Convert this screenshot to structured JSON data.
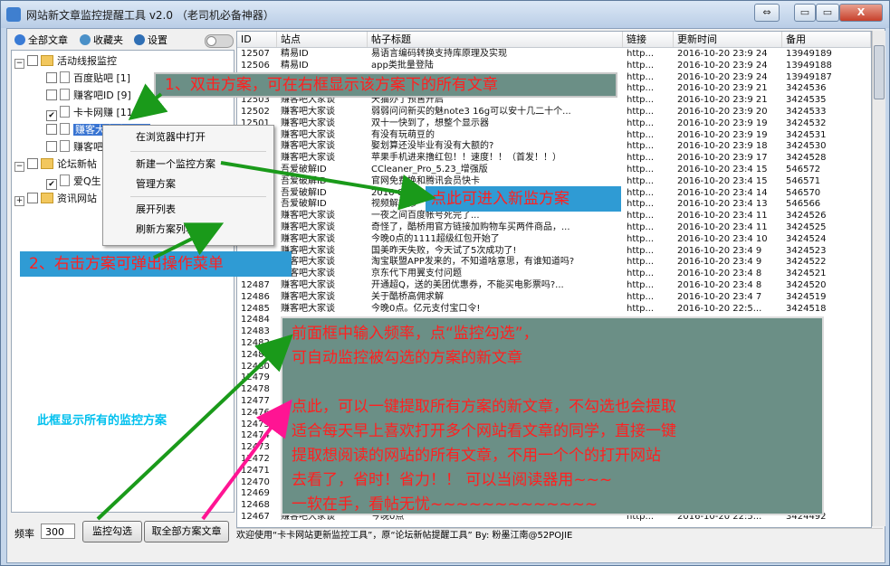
{
  "window": {
    "title": "网站新文章监控提醒工具 v2.0 （老司机必备神器）",
    "buttons": {
      "restore": "⇔",
      "minimize": "▭",
      "maximize": "▭",
      "close": "X"
    }
  },
  "toolbar": {
    "all_articles": "全部文章",
    "favorites": "收藏夹",
    "settings": "设置"
  },
  "tree": {
    "groups": [
      {
        "label": "活动线报监控",
        "items": [
          {
            "label": "百度贴吧 [1]",
            "checked": false
          },
          {
            "label": "赚客吧ID [9]",
            "checked": false
          },
          {
            "label": "卡卡网赚 [11]",
            "checked": true
          },
          {
            "label": "赚客大家谈 [15]",
            "checked": false,
            "selected": true
          },
          {
            "label": "赚客吧",
            "checked": false
          }
        ]
      },
      {
        "label": "论坛新帖",
        "items": [
          {
            "label": "爱Q生",
            "checked": true
          }
        ]
      },
      {
        "label": "资讯网站",
        "items": []
      }
    ],
    "note": "此框显示所有的监控方案"
  },
  "context_menu": {
    "items": [
      "在浏览器中打开",
      "新建一个监控方案",
      "管理方案",
      "展开列表",
      "刷新方案列表"
    ]
  },
  "bottom": {
    "freq_label": "频率",
    "freq_value": "300",
    "monitor_button": "监控勾选",
    "fetch_all_button": "取全部方案文章"
  },
  "list": {
    "columns": [
      "ID",
      "站点",
      "帖子标题",
      "链接",
      "更新时间",
      "备用"
    ],
    "rows": [
      [
        "12507",
        "精易ID",
        "易语言编码转换支持库原理及实现",
        "http...",
        "2016-10-20 23:9 24",
        "13949189"
      ],
      [
        "12506",
        "精易ID",
        "app类批量登陆",
        "http...",
        "2016-10-20 23:9 24",
        "13949188"
      ],
      [
        "",
        "",
        "",
        "http...",
        "2016-10-20 23:9 24",
        "13949187"
      ],
      [
        "",
        "",
        "",
        "http...",
        "2016-10-20 23:9 21",
        "3424536"
      ],
      [
        "12503",
        "赚客吧大家谈",
        "天猫办了预售开启",
        "http...",
        "2016-10-20 23:9 21",
        "3424535"
      ],
      [
        "12502",
        "赚客吧大家谈",
        "弱弱问问新买的魅note3 16g可以安十几二十个...",
        "http...",
        "2016-10-20 23:9 20",
        "3424533"
      ],
      [
        "12501",
        "赚客吧大家谈",
        "双十一快到了，想整个显示器",
        "http...",
        "2016-10-20 23:9 19",
        "3424532"
      ],
      [
        "",
        "赚客吧大家谈",
        "有没有玩萌豆的",
        "http...",
        "2016-10-20 23:9 19",
        "3424531"
      ],
      [
        "",
        "赚客吧大家谈",
        "娶划算还没毕业有没有大额的?",
        "http...",
        "2016-10-20 23:9 18",
        "3424530"
      ],
      [
        "",
        "赚客吧大家谈",
        "苹果手机进来撸红包！！速度！！（首发！！）",
        "http...",
        "2016-10-20 23:9 17",
        "3424528"
      ],
      [
        "",
        "吾爱破解ID",
        "CCleaner_Pro_5.23_增强版",
        "http...",
        "2016-10-20 23:4 15",
        "546572"
      ],
      [
        "",
        "吾爱破解ID",
        "官网免费换和腾讯会员快卡",
        "http...",
        "2016-10-20 23:4 15",
        "546571"
      ],
      [
        "",
        "吾爱破解ID",
        "2016 Google",
        "http...",
        "2016-10-20 23:4 14",
        "546570"
      ],
      [
        "",
        "吾爱破解ID",
        "视频解析修",
        "http...",
        "2016-10-20 23:4 13",
        "546566"
      ],
      [
        "",
        "赚客吧大家谈",
        "一夜之间百度帐号死完了...",
        "http...",
        "2016-10-20 23:4 11",
        "3424526"
      ],
      [
        "",
        "赚客吧大家谈",
        "奇怪了，酷桥用官方链接加购物车买两件商品，...",
        "http...",
        "2016-10-20 23:4 11",
        "3424525"
      ],
      [
        "",
        "赚客吧大家谈",
        "今晚0点的1111超级红包开始了",
        "http...",
        "2016-10-20 23:4 10",
        "3424524"
      ],
      [
        "",
        "赚客吧大家谈",
        "国美昨天失败，今天试了5次成功了!",
        "http...",
        "2016-10-20 23:4 9",
        "3424523"
      ],
      [
        "",
        "赚客吧大家谈",
        "淘宝联盟APP发来的，不知道啥意思，有谁知道吗?",
        "http...",
        "2016-10-20 23:4 9",
        "3424522"
      ],
      [
        "",
        "赚客吧大家谈",
        "京东代下用翼支付问题",
        "http...",
        "2016-10-20 23:4 8",
        "3424521"
      ],
      [
        "12487",
        "赚客吧大家谈",
        "开通超Q，送的美团优惠券，不能买电影票吗?...",
        "http...",
        "2016-10-20 23:4 8",
        "3424520"
      ],
      [
        "12486",
        "赚客吧大家谈",
        "关于酷桥高佣求解",
        "http...",
        "2016-10-20 23:4 7",
        "3424519"
      ],
      [
        "12485",
        "赚客吧大家谈",
        "今晚0点。亿元支付宝口令!",
        "http...",
        "2016-10-20 22:5...",
        "3424518"
      ],
      [
        "12484",
        "",
        "",
        "",
        "",
        ""
      ],
      [
        "12483",
        "",
        "",
        "",
        "",
        ""
      ],
      [
        "12482",
        "",
        "",
        "",
        "",
        ""
      ],
      [
        "12481",
        "",
        "",
        "",
        "",
        ""
      ],
      [
        "12480",
        "",
        "",
        "",
        "",
        ""
      ],
      [
        "12479",
        "",
        "",
        "",
        "",
        ""
      ],
      [
        "12478",
        "",
        "",
        "",
        "",
        "6"
      ],
      [
        "12477",
        "",
        "",
        "",
        "",
        "6"
      ],
      [
        "12476",
        "",
        "",
        "",
        "",
        ""
      ],
      [
        "12475",
        "",
        "",
        "",
        "",
        ""
      ],
      [
        "12474",
        "",
        "",
        "",
        "",
        ""
      ],
      [
        "12473",
        "",
        "",
        "",
        "",
        ""
      ],
      [
        "12472",
        "",
        "",
        "",
        "",
        ""
      ],
      [
        "12471",
        "",
        "",
        "",
        "",
        ""
      ],
      [
        "12470",
        "",
        "",
        "",
        "",
        ""
      ],
      [
        "12469",
        "",
        "",
        "",
        "",
        ""
      ],
      [
        "12468",
        "",
        "",
        "",
        "",
        ""
      ],
      [
        "12467",
        "赚客吧大家谈",
        "今晚0点",
        "http...",
        "2016-10-20 22:5...",
        "3424492"
      ]
    ]
  },
  "statusbar": "欢迎使用“卡卡网站更新监控工具”，原“论坛新帖提醒工具” By: 粉墨江南@52POJIE",
  "annotations": {
    "a1": "1、双击方案，可在右框显示该方案下的所有文章",
    "a2": "2、右击方案可弹出操作菜单",
    "a3": "点此可进入新监方案",
    "big": [
      "前面框中输入频率，点“监控勾选”，",
      "可自动监控被勾选的方案的新文章",
      "",
      "点此，可以一键提取所有方案的新文章，不勾选也会提取",
      "适合每天早上喜欢打开多个网站看文章的同学，直接一键",
      "提取想阅读的网站的所有文章，不用一个个的打开网站",
      "去看了，省时！省力！！ 可以当阅读器用~~~",
      "一软在手，看帖无忧~~~~~~~~~~~~~"
    ]
  },
  "colors": {
    "annotation_text": "#ff2020",
    "note_text": "#00c0ee",
    "arrow_green": "#1a9a1a",
    "arrow_pink": "#ff1493"
  }
}
